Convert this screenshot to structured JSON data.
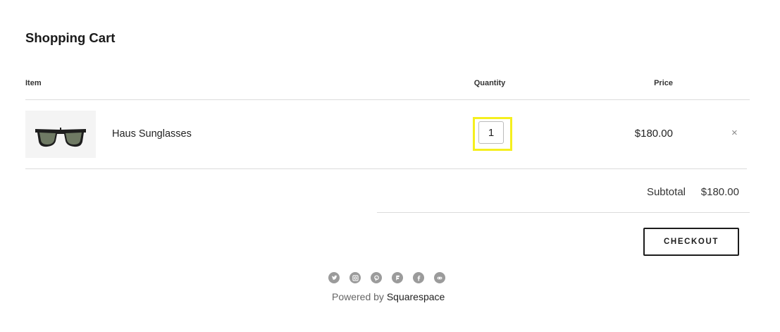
{
  "cart": {
    "title": "Shopping Cart",
    "columns": {
      "item": "Item",
      "quantity": "Quantity",
      "price": "Price"
    },
    "items": [
      {
        "name": "Haus Sunglasses",
        "quantity": "1",
        "price": "$180.00",
        "remove_glyph": "×",
        "thumbnail_icon": "sunglasses"
      }
    ],
    "subtotal_label": "Subtotal",
    "subtotal_value": "$180.00",
    "checkout_label": "CHECKOUT"
  },
  "footer": {
    "social_icons": [
      "twitter",
      "instagram",
      "pinterest",
      "foursquare",
      "facebook",
      "flickr"
    ],
    "powered_prefix": "Powered by",
    "powered_brand": "Squarespace"
  },
  "colors": {
    "highlight": "#f5ef1e",
    "social_icon": "#9b9b9b"
  }
}
